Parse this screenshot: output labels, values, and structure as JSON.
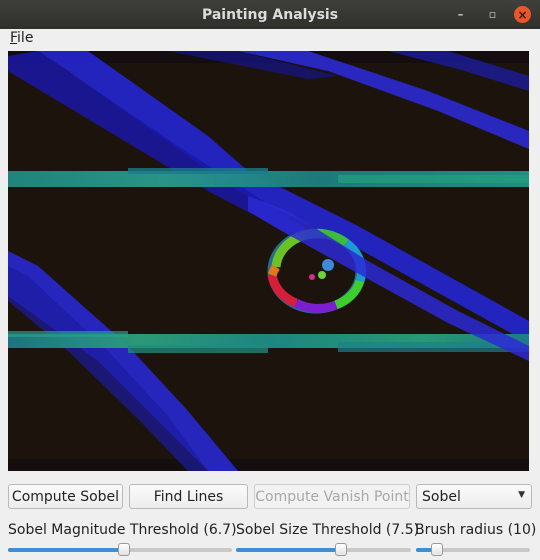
{
  "window": {
    "title": "Painting Analysis",
    "minimize_glyph": "–",
    "maximize_glyph": "▫",
    "close_glyph": "×"
  },
  "menu": {
    "file_mnemonic": "F",
    "file_rest": "ile"
  },
  "canvas": {
    "description_icon": "sobel-gradient-image",
    "background_color": "#1d130d"
  },
  "buttons": {
    "compute_sobel": "Compute Sobel",
    "find_lines": "Find Lines",
    "compute_vanish_point": "Compute Vanish Point"
  },
  "mode_select": {
    "value": "Sobel"
  },
  "sliders": [
    {
      "label": "Sobel Magnitude Threshold (6.7)",
      "value_fraction": 0.52
    },
    {
      "label": "Sobel Size Threshold (7.5)",
      "value_fraction": 0.6
    },
    {
      "label": "Brush radius (10)",
      "value_fraction": 0.18
    }
  ],
  "colors": {
    "accent": "#3d8fd6",
    "close_button": "#e8562a"
  }
}
